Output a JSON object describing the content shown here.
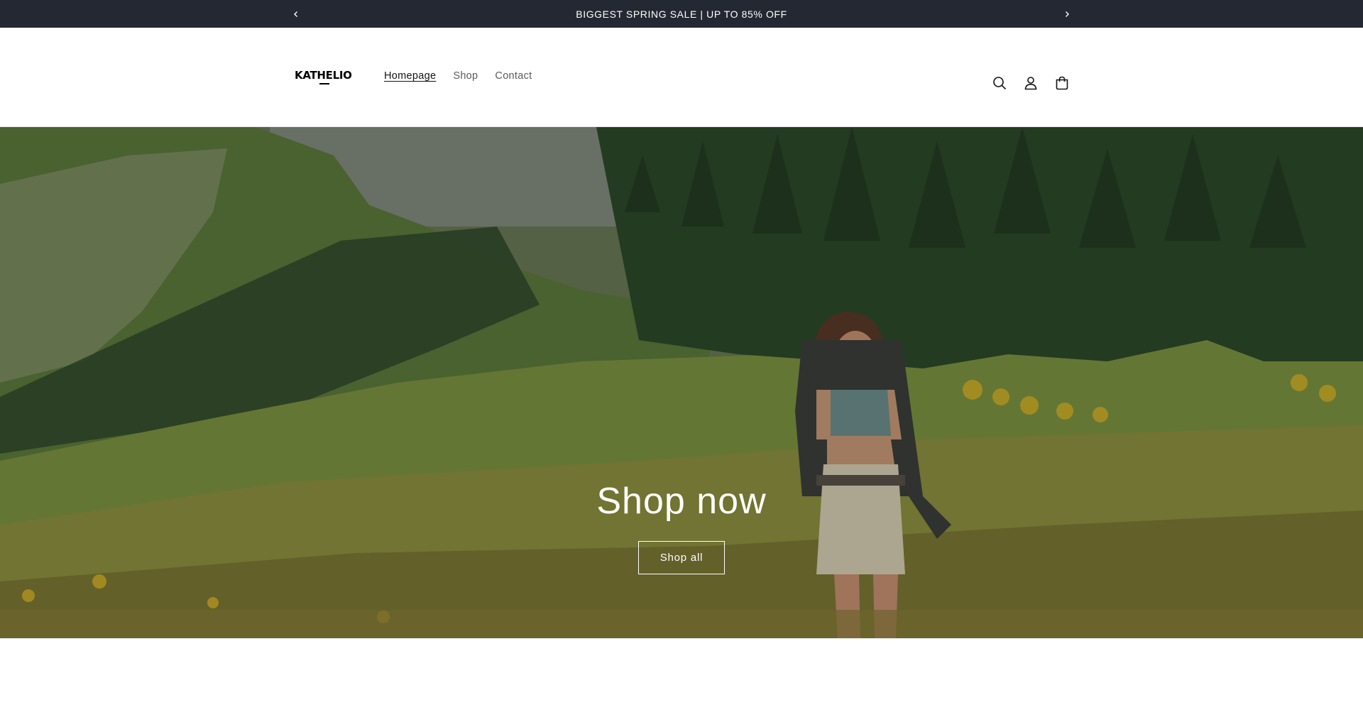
{
  "announcement": {
    "text": "BIGGEST SPRING SALE | UP TO 85% OFF",
    "prev_icon": "chevron-left-icon",
    "next_icon": "chevron-right-icon"
  },
  "header": {
    "logo_text": "KATHELIO",
    "nav": [
      {
        "label": "Homepage",
        "active": true
      },
      {
        "label": "Shop",
        "active": false
      },
      {
        "label": "Contact",
        "active": false
      }
    ],
    "icons": [
      "search-icon",
      "account-icon",
      "cart-icon"
    ]
  },
  "hero": {
    "title": "Shop now",
    "button_label": "Shop all"
  },
  "colors": {
    "announcement_bg": "#242833",
    "text": "#121212",
    "nav_muted": "#5a5a5a",
    "hero_text": "#ffffff"
  }
}
